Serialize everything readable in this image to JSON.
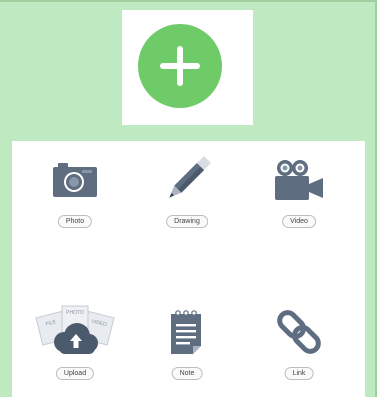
{
  "add_button": {
    "icon": "plus-icon",
    "color": "#6fcb68"
  },
  "tiles": [
    {
      "label": "Photo",
      "icon": "camera-icon"
    },
    {
      "label": "Drawing",
      "icon": "pencil-icon"
    },
    {
      "label": "Video",
      "icon": "video-camera-icon"
    },
    {
      "label": "Upload",
      "icon": "cloud-upload-icon",
      "icon_text": [
        "FILE",
        "PHOTO",
        "VIDEO"
      ]
    },
    {
      "label": "Note",
      "icon": "notepad-icon"
    },
    {
      "label": "Link",
      "icon": "chain-link-icon"
    }
  ],
  "colors": {
    "background": "#bfe9c0",
    "icon": "#5e6d80"
  }
}
